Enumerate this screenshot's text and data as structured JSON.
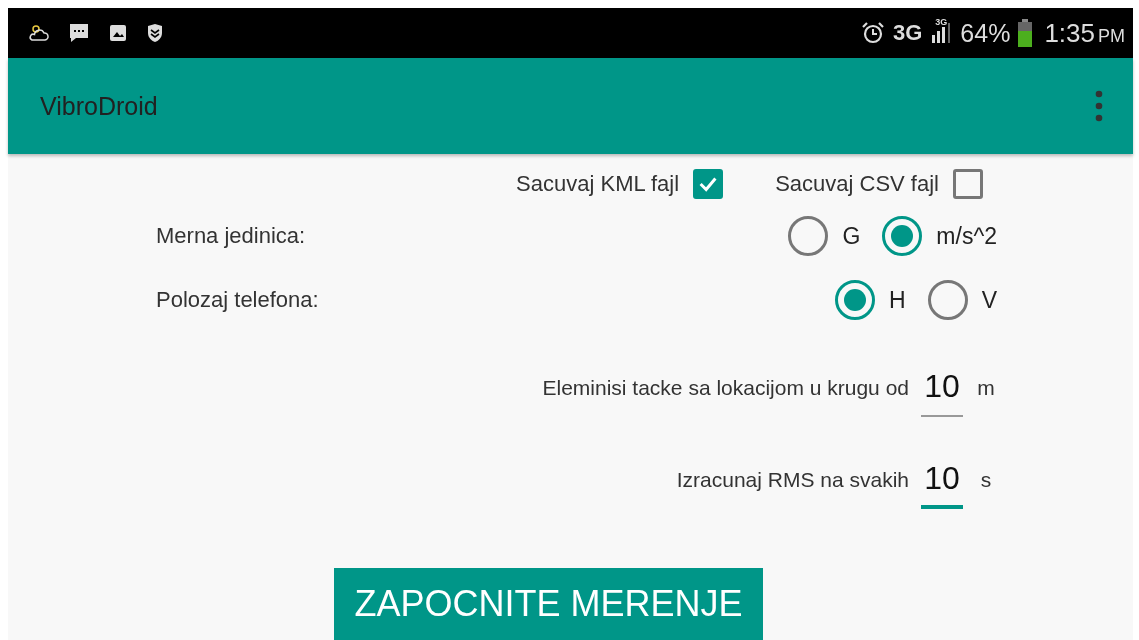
{
  "status_bar": {
    "network": "3G",
    "signal_label": "3G",
    "battery": "64%",
    "time": "1:35",
    "time_suffix": "PM"
  },
  "app_bar": {
    "title": "VibroDroid"
  },
  "checkboxes": [
    {
      "label": "Sacuvaj KML fajl",
      "checked": true
    },
    {
      "label": "Sacuvaj CSV fajl",
      "checked": false
    }
  ],
  "radio_groups": [
    {
      "label": "Merna jedinica:",
      "options": [
        {
          "label": "G",
          "selected": false
        },
        {
          "label": "m/s^2",
          "selected": true
        }
      ]
    },
    {
      "label": "Polozaj telefona:",
      "options": [
        {
          "label": "H",
          "selected": true
        },
        {
          "label": "V",
          "selected": false
        }
      ]
    }
  ],
  "fields": [
    {
      "label": "Eleminisi tacke sa lokacijom u krugu od",
      "value": "10",
      "unit": "m",
      "focused": false
    },
    {
      "label": "Izracunaj RMS na svakih",
      "value": "10",
      "unit": "s",
      "focused": true
    }
  ],
  "button": {
    "label": "ZAPOCNITE MERENJE"
  }
}
